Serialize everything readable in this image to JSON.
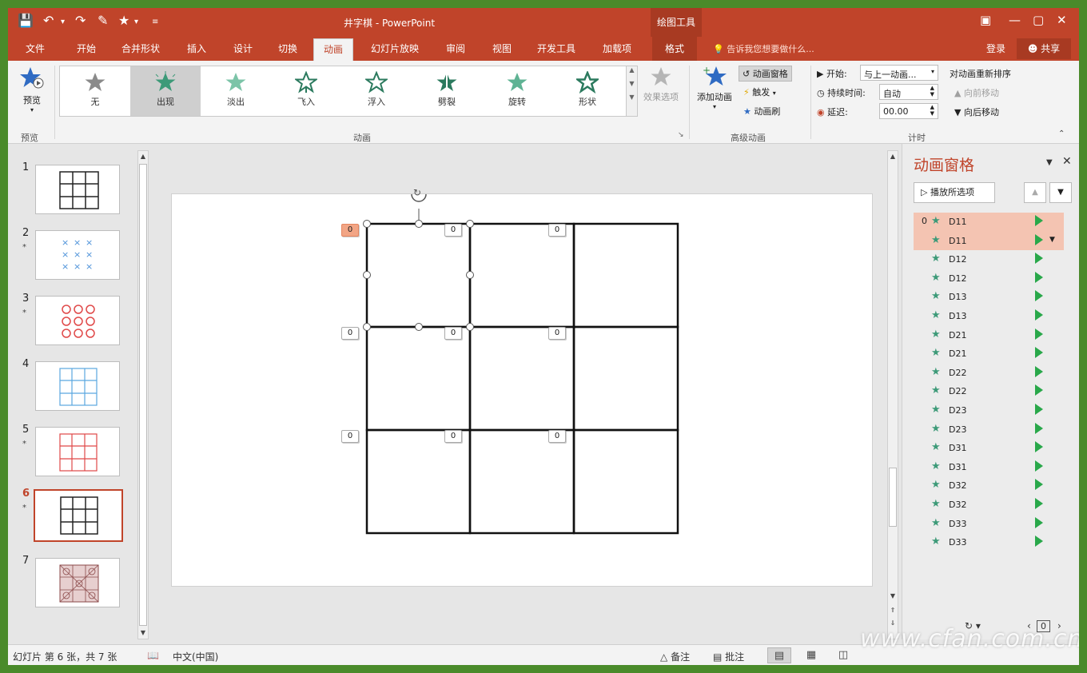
{
  "app": {
    "title": "井字棋 - PowerPoint",
    "context_tools": "绘图工具",
    "login": "登录",
    "share": "共享",
    "tell_me": "告诉我您想要做什么..."
  },
  "tabs": [
    {
      "label": "文件"
    },
    {
      "label": "开始"
    },
    {
      "label": "合并形状"
    },
    {
      "label": "插入"
    },
    {
      "label": "设计"
    },
    {
      "label": "切换"
    },
    {
      "label": "动画"
    },
    {
      "label": "幻灯片放映"
    },
    {
      "label": "审阅"
    },
    {
      "label": "视图"
    },
    {
      "label": "开发工具"
    },
    {
      "label": "加载项"
    },
    {
      "label": "格式"
    }
  ],
  "ribbon": {
    "preview": {
      "label": "预览",
      "group": "预览"
    },
    "animation_group": "动画",
    "gallery": [
      {
        "label": "无"
      },
      {
        "label": "出现"
      },
      {
        "label": "淡出"
      },
      {
        "label": "飞入"
      },
      {
        "label": "浮入"
      },
      {
        "label": "劈裂"
      },
      {
        "label": "旋转"
      },
      {
        "label": "形状"
      }
    ],
    "effect_options": "效果选项",
    "advanced": {
      "group": "高级动画",
      "add_animation": "添加动画",
      "animation_pane": "动画窗格",
      "trigger": "触发",
      "animation_painter": "动画刷"
    },
    "timing": {
      "group": "计时",
      "start_label": "开始:",
      "start_value": "与上一动画...",
      "duration_label": "持续时间:",
      "duration_value": "自动",
      "delay_label": "延迟:",
      "delay_value": "00.00",
      "reorder_title": "对动画重新排序",
      "move_earlier": "向前移动",
      "move_later": "向后移动"
    }
  },
  "slides": [
    {
      "number": "1",
      "star": ""
    },
    {
      "number": "2",
      "star": "*"
    },
    {
      "number": "3",
      "star": "*"
    },
    {
      "number": "4",
      "star": ""
    },
    {
      "number": "5",
      "star": "*"
    },
    {
      "number": "6",
      "star": "*"
    },
    {
      "number": "7",
      "star": ""
    }
  ],
  "canvas": {
    "tags": [
      "0",
      "0",
      "0",
      "0",
      "0",
      "0",
      "0",
      "0",
      "0"
    ]
  },
  "anim_pane": {
    "title": "动画窗格",
    "play_button": "播放所选项",
    "first_index": "0",
    "items": [
      {
        "name": "D11"
      },
      {
        "name": "D11"
      },
      {
        "name": "D12"
      },
      {
        "name": "D12"
      },
      {
        "name": "D13"
      },
      {
        "name": "D13"
      },
      {
        "name": "D21"
      },
      {
        "name": "D21"
      },
      {
        "name": "D22"
      },
      {
        "name": "D22"
      },
      {
        "name": "D23"
      },
      {
        "name": "D23"
      },
      {
        "name": "D31"
      },
      {
        "name": "D31"
      },
      {
        "name": "D32"
      },
      {
        "name": "D32"
      },
      {
        "name": "D33"
      },
      {
        "name": "D33"
      }
    ],
    "page_indicator": "0"
  },
  "status": {
    "slide_info": "幻灯片 第 6 张，共 7 张",
    "language": "中文(中国)",
    "notes": "备注",
    "comments": "批注"
  },
  "watermark": "www.cfan.com.cn",
  "colors": {
    "accent": "#c0442a",
    "selection": "#f4c4b2",
    "anim_star": "#3d9a78",
    "play_triangle": "#29a84a"
  }
}
